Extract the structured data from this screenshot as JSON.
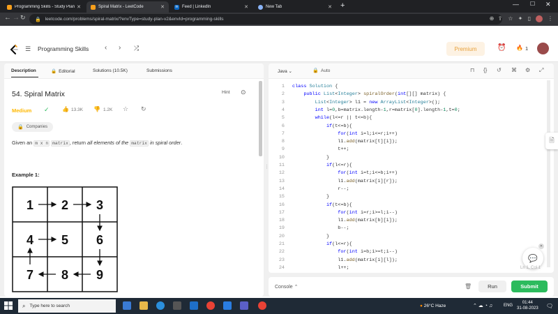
{
  "browser": {
    "tabs": [
      {
        "title": "Programming Skills - Study Plan",
        "favicon_color": "#f89f1b"
      },
      {
        "title": "Spiral Matrix - LeetCode",
        "favicon_color": "#f89f1b"
      },
      {
        "title": "Feed | LinkedIn",
        "favicon_color": "#0a66c2",
        "favicon_text": "in"
      },
      {
        "title": "New Tab",
        "favicon_color": "#8ab4f8"
      }
    ],
    "url": "leetcode.com/problems/spiral-matrix/?envType=study-plan-v2&envId=programming-skills"
  },
  "header": {
    "title": "Programming Skills",
    "premium_label": "Premium",
    "streak": "1"
  },
  "left_tabs": [
    {
      "label": "Description"
    },
    {
      "label": "Editorial"
    },
    {
      "label": "Solutions (10.5K)"
    },
    {
      "label": "Submissions"
    }
  ],
  "problem": {
    "title": "54. Spiral Matrix",
    "hint_label": "Hint",
    "difficulty": "Medium",
    "likes": "13.3K",
    "dislikes": "1.2K",
    "companies_label": "Companies",
    "statement": {
      "p1": "Given an ",
      "c1": "m x n",
      "p2": " ",
      "c2": "matrix",
      "p3": ", return ",
      "em": "all elements of the",
      "p4": " ",
      "c3": "matrix",
      "p5": " ",
      "em2": "in spiral order",
      "p6": "."
    },
    "example_title": "Example 1:",
    "matrix_values": [
      "1",
      "2",
      "3",
      "4",
      "5",
      "6",
      "7",
      "8",
      "9"
    ]
  },
  "editor": {
    "language": "Java",
    "mode": "Auto",
    "cursor": "Ln 1, Col 1",
    "lines": [
      [
        [
          "kw",
          "class"
        ],
        [
          "t",
          " "
        ],
        [
          "ty",
          "Solution"
        ],
        [
          "t",
          " {"
        ]
      ],
      [
        [
          "t",
          "    "
        ],
        [
          "kw",
          "public"
        ],
        [
          "t",
          " "
        ],
        [
          "ty",
          "List"
        ],
        [
          "t",
          "<"
        ],
        [
          "ty",
          "Integer"
        ],
        [
          "t",
          "> "
        ],
        [
          "fn",
          "spiralOrder"
        ],
        [
          "t",
          "("
        ],
        [
          "kw",
          "int"
        ],
        [
          "t",
          "[][] matrix) {"
        ]
      ],
      [
        [
          "t",
          "        "
        ],
        [
          "ty",
          "List"
        ],
        [
          "t",
          "<"
        ],
        [
          "ty",
          "Integer"
        ],
        [
          "t",
          "> l1 = "
        ],
        [
          "kw",
          "new"
        ],
        [
          "t",
          " "
        ],
        [
          "ty",
          "ArrayList"
        ],
        [
          "t",
          "<"
        ],
        [
          "ty",
          "Integer"
        ],
        [
          "t",
          ">();"
        ]
      ],
      [
        [
          "t",
          "        "
        ],
        [
          "kw",
          "int"
        ],
        [
          "t",
          " l="
        ],
        [
          "nm",
          "0"
        ],
        [
          "t",
          ",b=matrix.length-"
        ],
        [
          "nm",
          "1"
        ],
        [
          "t",
          ",r=matrix["
        ],
        [
          "nm",
          "0"
        ],
        [
          "t",
          "].length-"
        ],
        [
          "nm",
          "1"
        ],
        [
          "t",
          ",t="
        ],
        [
          "nm",
          "0"
        ],
        [
          "t",
          ";"
        ]
      ],
      [
        [
          "t",
          "        "
        ],
        [
          "kw",
          "while"
        ],
        [
          "t",
          "(l<=r || t<=b){"
        ]
      ],
      [
        [
          "t",
          "            "
        ],
        [
          "kw",
          "if"
        ],
        [
          "t",
          "(t<=b){"
        ]
      ],
      [
        [
          "t",
          "                "
        ],
        [
          "kw",
          "for"
        ],
        [
          "t",
          "("
        ],
        [
          "kw",
          "int"
        ],
        [
          "t",
          " i=l;i<=r;i++)"
        ]
      ],
      [
        [
          "t",
          "                l1."
        ],
        [
          "fn",
          "add"
        ],
        [
          "t",
          "(matrix[t][i]);"
        ]
      ],
      [
        [
          "t",
          "                t++;"
        ]
      ],
      [
        [
          "t",
          "            }"
        ]
      ],
      [
        [
          "t",
          "            "
        ],
        [
          "kw",
          "if"
        ],
        [
          "t",
          "(l<=r){"
        ]
      ],
      [
        [
          "t",
          "                "
        ],
        [
          "kw",
          "for"
        ],
        [
          "t",
          "("
        ],
        [
          "kw",
          "int"
        ],
        [
          "t",
          " i=t;i<=b;i++)"
        ]
      ],
      [
        [
          "t",
          "                l1."
        ],
        [
          "fn",
          "add"
        ],
        [
          "t",
          "(matrix[i][r]);"
        ]
      ],
      [
        [
          "t",
          "                r--;"
        ]
      ],
      [
        [
          "t",
          "            }"
        ]
      ],
      [
        [
          "t",
          "            "
        ],
        [
          "kw",
          "if"
        ],
        [
          "t",
          "(t<=b){"
        ]
      ],
      [
        [
          "t",
          "                "
        ],
        [
          "kw",
          "for"
        ],
        [
          "t",
          "("
        ],
        [
          "kw",
          "int"
        ],
        [
          "t",
          " i=r;i>=l;i--)"
        ]
      ],
      [
        [
          "t",
          "                l1."
        ],
        [
          "fn",
          "add"
        ],
        [
          "t",
          "(matrix[b][i]);"
        ]
      ],
      [
        [
          "t",
          "                b--;"
        ]
      ],
      [
        [
          "t",
          "            }"
        ]
      ],
      [
        [
          "t",
          "            "
        ],
        [
          "kw",
          "if"
        ],
        [
          "t",
          "(l<=r){"
        ]
      ],
      [
        [
          "t",
          "                "
        ],
        [
          "kw",
          "for"
        ],
        [
          "t",
          "("
        ],
        [
          "kw",
          "int"
        ],
        [
          "t",
          " i=b;i>=t;i--)"
        ]
      ],
      [
        [
          "t",
          "                l1."
        ],
        [
          "fn",
          "add"
        ],
        [
          "t",
          "(matrix[i][l]);"
        ]
      ],
      [
        [
          "t",
          "                l++;"
        ]
      ]
    ]
  },
  "console": {
    "console_label": "Console",
    "run_label": "Run",
    "submit_label": "Submit"
  },
  "taskbar": {
    "search_placeholder": "Type here to search",
    "weather": "26°C  Haze",
    "language": "ENG",
    "time": "01:44",
    "date": "31-08-2023"
  },
  "colors": {
    "accent_green": "#2cbb5d",
    "medium": "#ffb800",
    "premium": "#e7a13b"
  }
}
